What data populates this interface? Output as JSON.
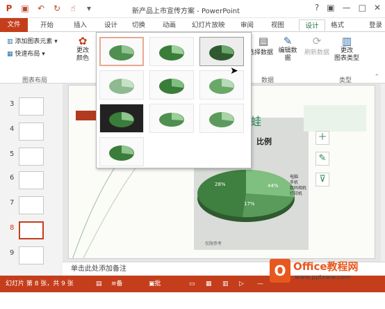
{
  "titlebar": {
    "title": "新产品上市宣传方案 - PowerPoint",
    "help": "?",
    "minimize": "—",
    "restore": "□",
    "close": "✕"
  },
  "tabs": {
    "file": "文件",
    "home": "开始",
    "insert": "插入",
    "design": "设计",
    "transitions": "切换",
    "animations": "动画",
    "slideshow": "幻灯片放映",
    "review": "审阅",
    "view": "视图",
    "chart_design": "设计",
    "format": "格式",
    "login": "登录"
  },
  "ribbon": {
    "add_element": "添加图表元素",
    "quick_layout": "快速布局",
    "change_colors": "更改\n颜色",
    "group_layout": "图表布局",
    "select_data": "选择数据",
    "edit_data": "编辑数\n据",
    "refresh_data": "刷新数据",
    "group_data": "数据",
    "change_type": "更改\n图表类型",
    "group_type": "类型"
  },
  "slides": {
    "numbers": [
      "3",
      "4",
      "5",
      "6",
      "7",
      "8",
      "9"
    ],
    "current": "8"
  },
  "slide": {
    "title_partial": "比例",
    "brand_text": "蛙 蛙",
    "labels": [
      "44%",
      "17%",
      "28%"
    ],
    "legend": [
      "电脑",
      "手机",
      "数码相机",
      "打印机"
    ],
    "footnote": "仅限参考"
  },
  "notes": {
    "placeholder": "单击此处添加备注"
  },
  "status": {
    "slide_info": "幻灯片 第 8 张，共 9 张",
    "notes_btn": "备注",
    "comments_btn": "批注",
    "zoom": "—"
  },
  "watermark": {
    "text": "Office教程网",
    "url": "www.pptxww.com"
  },
  "colors": {
    "accent": "#c43e1c",
    "chart_green": "#217346",
    "pie_main": "#3a7d3a",
    "pie_light": "#8fc48f",
    "pie_dark": "#2f5a2f"
  }
}
